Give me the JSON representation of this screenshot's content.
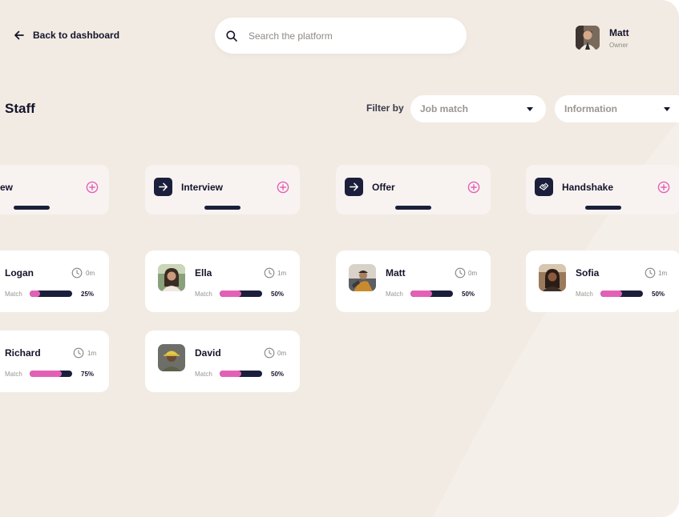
{
  "header": {
    "back_label": "Back to dashboard",
    "search_placeholder": "Search the platform",
    "user": {
      "name": "Matt",
      "role": "Owner"
    }
  },
  "page_title": "Staff",
  "filters": {
    "label": "Filter by",
    "job_match": "Job match",
    "information": "Information"
  },
  "columns": [
    {
      "title": "ew",
      "icon": "partial-column-icon"
    },
    {
      "title": "Interview",
      "icon": "arrow-right-icon"
    },
    {
      "title": "Offer",
      "icon": "arrow-right-icon"
    },
    {
      "title": "Handshake",
      "icon": "handshake-icon"
    }
  ],
  "cards": [
    {
      "name": "Logan",
      "time": "0m",
      "match_label": "Match",
      "match": 25,
      "match_text": "25%"
    },
    {
      "name": "Richard",
      "time": "1m",
      "match_label": "Match",
      "match": 75,
      "match_text": "75%"
    },
    {
      "name": "Ella",
      "time": "1m",
      "match_label": "Match",
      "match": 50,
      "match_text": "50%"
    },
    {
      "name": "David",
      "time": "0m",
      "match_label": "Match",
      "match": 50,
      "match_text": "50%"
    },
    {
      "name": "Matt",
      "time": "0m",
      "match_label": "Match",
      "match": 50,
      "match_text": "50%"
    },
    {
      "name": "Sofia",
      "time": "1m",
      "match_label": "Match",
      "match": 50,
      "match_text": "50%"
    }
  ],
  "colors": {
    "background": "#f1ebe3",
    "navy": "#1b1f3b",
    "accent_pink": "#e360b6"
  }
}
